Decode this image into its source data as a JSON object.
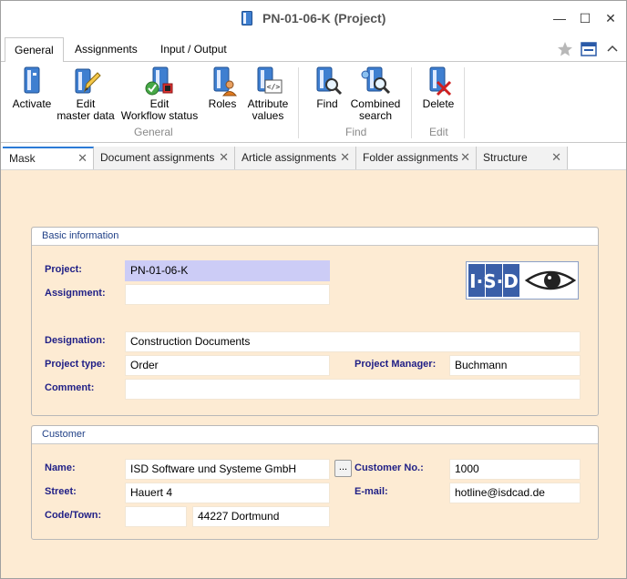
{
  "window": {
    "title": "PN-01-06-K (Project)",
    "controls": {
      "minimize": "—",
      "maximize": "☐",
      "close": "✕"
    }
  },
  "ribbon_tabs": [
    {
      "label": "General",
      "active": true
    },
    {
      "label": "Assignments",
      "active": false
    },
    {
      "label": "Input / Output",
      "active": false
    }
  ],
  "ribbon": {
    "general": {
      "label": "General",
      "activate": "Activate",
      "edit_master_1": "Edit",
      "edit_master_2": "master data",
      "edit_workflow_1": "Edit",
      "edit_workflow_2": "Workflow status",
      "roles": "Roles",
      "attr_1": "Attribute",
      "attr_2": "values"
    },
    "find": {
      "label": "Find",
      "find": "Find",
      "combined_1": "Combined",
      "combined_2": "search"
    },
    "edit": {
      "label": "Edit",
      "delete": "Delete"
    },
    "icons": [
      "activate-icon",
      "edit-master-data-icon",
      "workflow-status-icon",
      "roles-icon",
      "attribute-values-icon",
      "find-icon",
      "combined-search-icon",
      "delete-icon",
      "star-icon",
      "window-icon",
      "chevron-up-icon"
    ]
  },
  "doc_tabs": [
    {
      "label": "Mask",
      "close": "✕"
    },
    {
      "label": "Document assignments",
      "close": "✕"
    },
    {
      "label": "Article assignments",
      "close": "✕"
    },
    {
      "label": "Folder assignments",
      "close": "✕"
    },
    {
      "label": "Structure",
      "close": "✕"
    }
  ],
  "basic_info": {
    "title": "Basic information",
    "project_label": "Project:",
    "project_value": "PN-01-06-K",
    "assignment_label": "Assignment:",
    "assignment_value": "",
    "designation_label": "Designation:",
    "designation_value": "Construction Documents",
    "project_type_label": "Project type:",
    "project_type_value": "Order",
    "project_manager_label": "Project Manager:",
    "project_manager_value": "Buchmann",
    "comment_label": "Comment:",
    "comment_value": "",
    "logo_text": "I·S·D"
  },
  "customer": {
    "title": "Customer",
    "name_label": "Name:",
    "name_value": "ISD Software und Systeme GmbH",
    "ellipsis": "...",
    "customer_no_label": "Customer No.:",
    "customer_no_value": "1000",
    "street_label": "Street:",
    "street_value": "Hauert 4",
    "email_label": "E-mail:",
    "email_value": "hotline@isdcad.de",
    "code_town_label": "Code/Town:",
    "code_value": "",
    "town_value": "44227 Dortmund"
  },
  "colors": {
    "content_bg": "#fdebd3",
    "label_blue": "#1f1f86",
    "highlight_field": "#ccccf6",
    "active_tab_accent": "#2b7bd6"
  }
}
